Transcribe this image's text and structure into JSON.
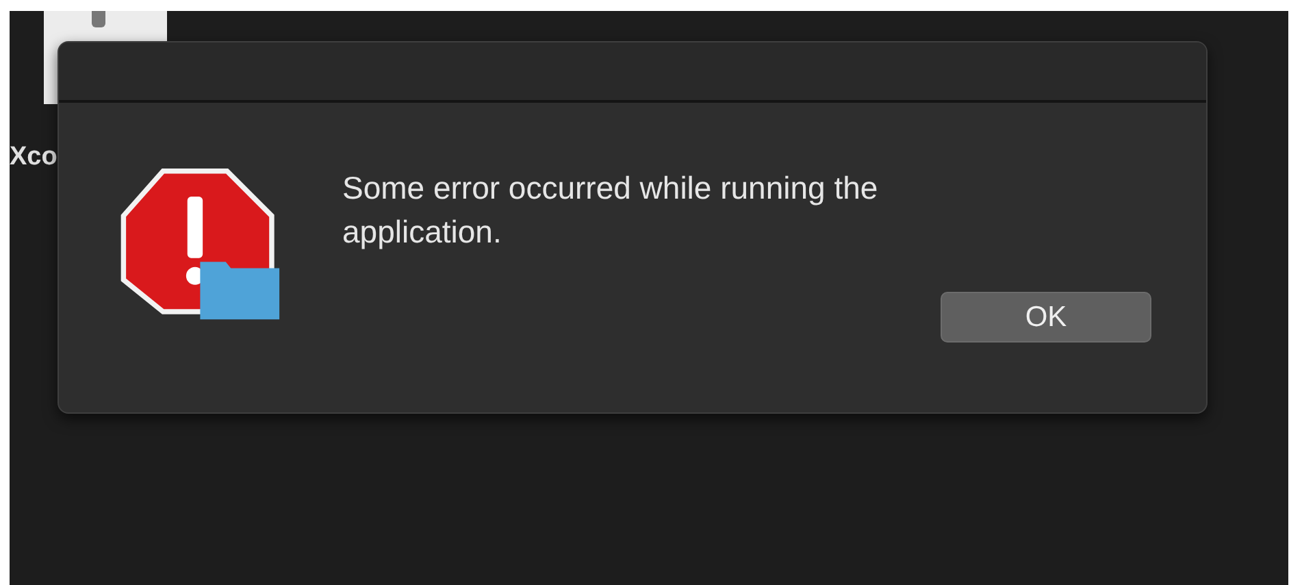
{
  "desktop": {
    "icon_label": "Xco"
  },
  "dialog": {
    "message": "Some error occurred while running the application.",
    "buttons": [
      "OK"
    ]
  }
}
